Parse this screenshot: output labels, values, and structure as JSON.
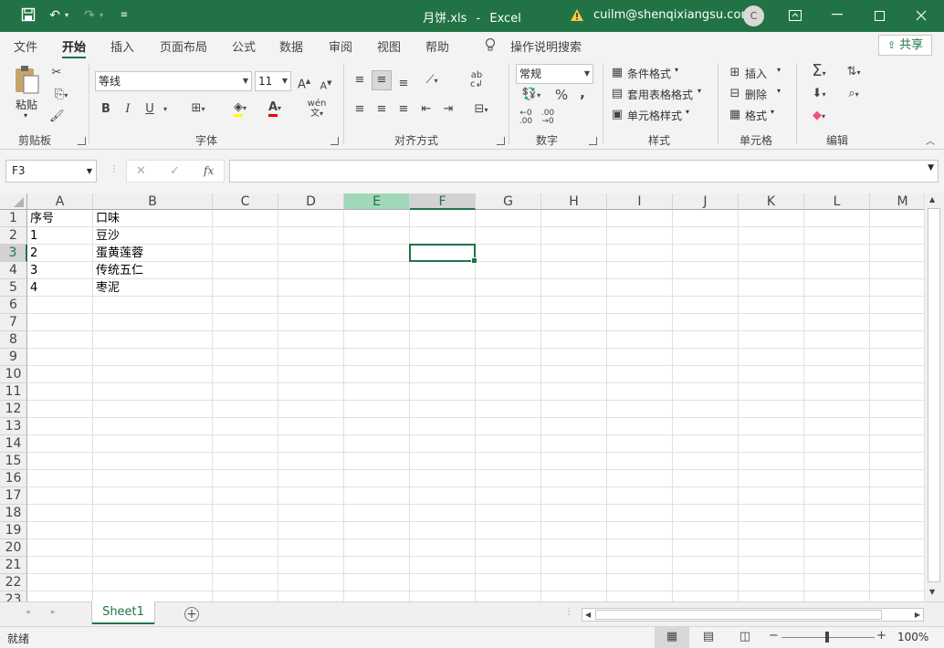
{
  "titlebar": {
    "filename": "月饼.xls",
    "separator": "-",
    "app": "Excel",
    "user": "cuilm@shenqixiangsu.com",
    "avatar_initial": "C",
    "colors": {
      "titlebar_bg": "#217346",
      "accent": "#217346"
    }
  },
  "menu": {
    "tabs": [
      "文件",
      "开始",
      "插入",
      "页面布局",
      "公式",
      "数据",
      "审阅",
      "视图",
      "帮助"
    ],
    "active_tab": "开始",
    "tell_me": "操作说明搜索",
    "share": "共享"
  },
  "ribbon": {
    "clipboard": {
      "paste": "粘贴",
      "label": "剪贴板"
    },
    "font": {
      "name": "等线",
      "size": "11",
      "bold": "B",
      "italic": "I",
      "underline": "U",
      "label": "字体"
    },
    "alignment": {
      "label": "对齐方式"
    },
    "number": {
      "format": "常规",
      "percent": "%",
      "comma": ",",
      "label": "数字"
    },
    "styles": {
      "conditional": "条件格式",
      "table": "套用表格格式",
      "cell": "单元格样式",
      "label": "样式"
    },
    "cells": {
      "insert": "插入",
      "delete": "删除",
      "format": "格式",
      "label": "单元格"
    },
    "editing": {
      "label": "编辑"
    }
  },
  "formula_bar": {
    "name_box": "F3",
    "cancel": "✕",
    "enter": "✓",
    "fx": "fx",
    "value": ""
  },
  "sheet": {
    "columns": [
      "A",
      "B",
      "C",
      "D",
      "E",
      "F",
      "G",
      "H",
      "I",
      "J",
      "K",
      "L",
      "M"
    ],
    "selected_column": "F",
    "highlighted_column": "E",
    "selected_row": 3,
    "rows": [
      "1",
      "2",
      "3",
      "4",
      "5",
      "6",
      "7",
      "8",
      "9",
      "10",
      "11",
      "12",
      "13",
      "14",
      "15",
      "16",
      "17",
      "18",
      "19",
      "20",
      "21",
      "22",
      "23"
    ],
    "cells": [
      [
        "序号",
        "口味"
      ],
      [
        "1",
        "豆沙"
      ],
      [
        "2",
        "蛋黄莲蓉"
      ],
      [
        "3",
        "传统五仁"
      ],
      [
        "4",
        "枣泥"
      ]
    ],
    "active_cell": "F3"
  },
  "sheet_tabs": {
    "tabs": [
      "Sheet1"
    ],
    "active": "Sheet1",
    "add": "+"
  },
  "status_bar": {
    "status": "就绪",
    "zoom": "100%",
    "zoom_level": 1.0
  }
}
